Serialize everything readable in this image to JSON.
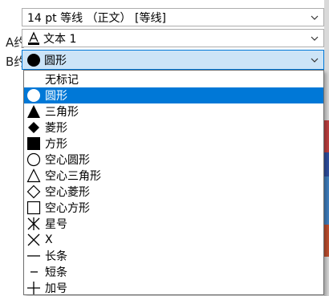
{
  "background": {
    "left_labels": [
      "A约",
      "B约"
    ]
  },
  "font_combo": {
    "value": "14 pt 等线 （正文） [等线]",
    "chevron": "chevron-down-icon"
  },
  "text_combo": {
    "value": "文本 1",
    "icon": "text-color-icon",
    "chevron": "chevron-down-icon"
  },
  "marker_combo": {
    "value": "圆形",
    "icon": "filled-circle-icon",
    "chevron": "chevron-down-icon"
  },
  "marker_list": {
    "selected_index": 1,
    "items": [
      {
        "label": "无标记",
        "icon": "none"
      },
      {
        "label": "圆形",
        "icon": "filled-circle-icon"
      },
      {
        "label": "三角形",
        "icon": "filled-triangle-icon"
      },
      {
        "label": "菱形",
        "icon": "filled-diamond-icon"
      },
      {
        "label": "方形",
        "icon": "filled-square-icon"
      },
      {
        "label": "空心圆形",
        "icon": "hollow-circle-icon"
      },
      {
        "label": "空心三角形",
        "icon": "hollow-triangle-icon"
      },
      {
        "label": "空心菱形",
        "icon": "hollow-diamond-icon"
      },
      {
        "label": "空心方形",
        "icon": "hollow-square-icon"
      },
      {
        "label": "星号",
        "icon": "asterisk-icon"
      },
      {
        "label": "X",
        "icon": "x-mark-icon"
      },
      {
        "label": "长条",
        "icon": "long-dash-icon"
      },
      {
        "label": "短条",
        "icon": "short-dash-icon"
      },
      {
        "label": "加号",
        "icon": "plus-icon"
      }
    ]
  },
  "colors": {
    "selection": "#0078d7",
    "active_combo_bg": "#cce4f7"
  }
}
